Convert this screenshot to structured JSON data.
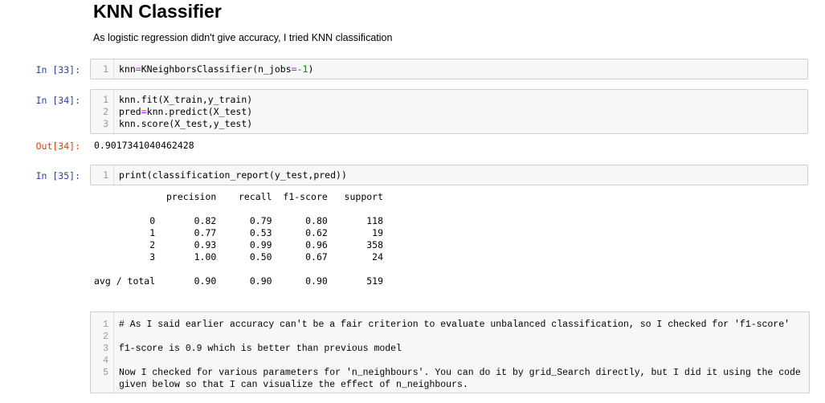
{
  "heading": "KNN Classifier",
  "intro": "As logistic regression didn't give accuracy, I tried KNN classification",
  "cells": [
    {
      "prompt": "In [33]:",
      "lines": [
        [
          "knn",
          "=",
          "KNeighborsClassifier(n_jobs",
          "=",
          "-1",
          ")"
        ]
      ]
    },
    {
      "prompt": "In [34]:",
      "lines": [
        [
          "knn.fit(X_train,y_train)"
        ],
        [
          "pred",
          "=",
          "knn.predict(X_test)"
        ],
        [
          "knn.score(X_test,y_test)"
        ]
      ],
      "out_prompt": "Out[34]:",
      "output": "0.9017341040462428"
    },
    {
      "prompt": "In [35]:",
      "lines": [
        [
          "print(classification_report(y_test,pred))"
        ]
      ],
      "output_lines": [
        "             precision    recall  f1-score   support",
        "",
        "          0       0.82      0.79      0.80       118",
        "          1       0.77      0.53      0.62        19",
        "          2       0.93      0.99      0.96       358",
        "          3       1.00      0.50      0.67        24",
        "",
        "avg / total       0.90      0.90      0.90       519"
      ]
    }
  ],
  "markdown_cell": {
    "lines": [
      {
        "n": "1",
        "text": "# As I said earlier accuracy can't be a fair criterion to evaluate unbalanced classification, so I checked for 'f1-score'"
      },
      {
        "n": "2",
        "text": ""
      },
      {
        "n": "3",
        "text": "f1-score is 0.9 which is better than previous model"
      },
      {
        "n": "4",
        "text": ""
      },
      {
        "n": "5",
        "text": "Now I checked for various parameters for 'n_neighbours'. You can do it by grid_Search directly, but I did it using the code given below so that I can visualize the effect of n_neighbours."
      }
    ]
  }
}
